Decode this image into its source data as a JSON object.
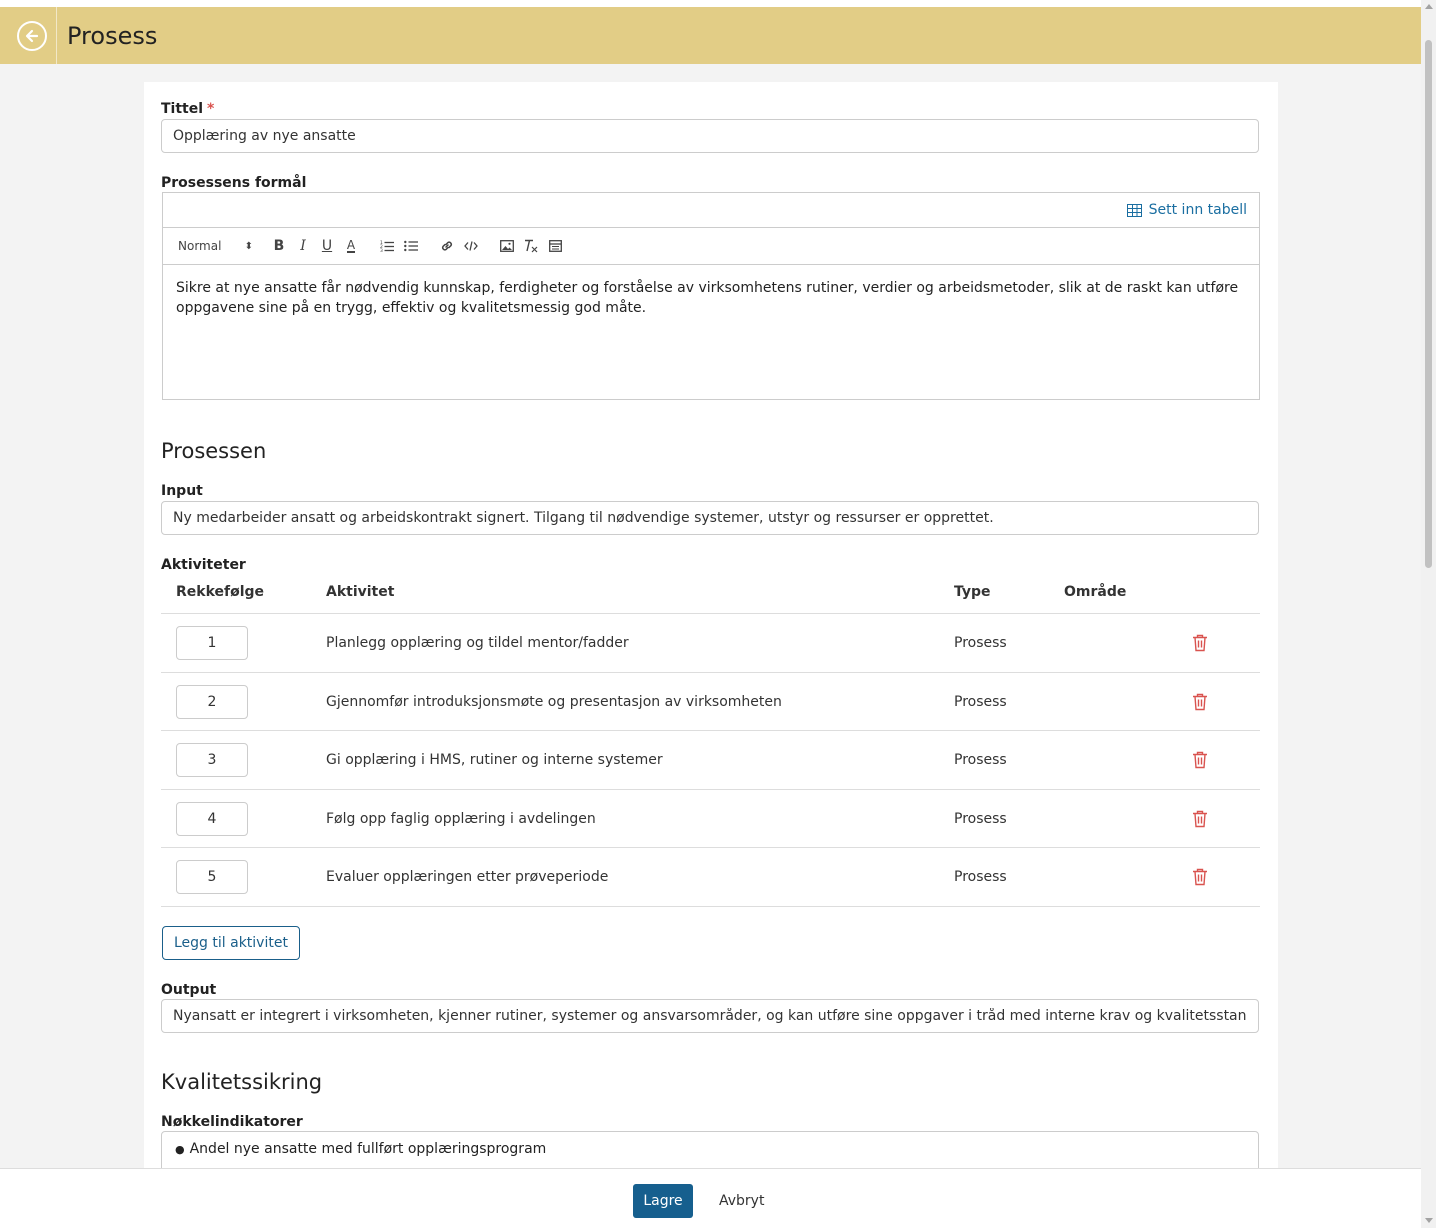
{
  "header": {
    "title": "Prosess",
    "back_icon": "arrow-left-circle-icon"
  },
  "form": {
    "title_label": "Tittel",
    "required_mark": "*",
    "title_value": "Opplæring av nye ansatte",
    "purpose_label": "Prosessens formål",
    "insert_table_label": "Sett inn tabell",
    "toolbar": {
      "format_select": "Normal",
      "format_arrows": "⬍",
      "bold": "B",
      "italic": "I",
      "underline": "U",
      "text_color": "A"
    },
    "purpose_text": "Sikre at nye ansatte får nødvendig kunnskap, ferdigheter og forståelse av virksomhetens rutiner, verdier og arbeidsmetoder, slik at de raskt kan utføre oppgavene sine på en trygg, effektiv og kvalitetsmessig god måte.",
    "section_process": "Prosessen",
    "input_label": "Input",
    "input_value": "Ny medarbeider ansatt og arbeidskontrakt signert. Tilgang til nødvendige systemer, utstyr og ressurser er opprettet.",
    "activities_label": "Aktiviteter",
    "columns": {
      "order": "Rekkefølge",
      "activity": "Aktivitet",
      "type": "Type",
      "area": "Område"
    },
    "activities": [
      {
        "order": "1",
        "activity": "Planlegg opplæring og tildel mentor/fadder",
        "type": "Prosess",
        "area": ""
      },
      {
        "order": "2",
        "activity": "Gjennomfør introduksjonsmøte og presentasjon av virksomheten",
        "type": "Prosess",
        "area": ""
      },
      {
        "order": "3",
        "activity": "Gi opplæring i HMS, rutiner og interne systemer",
        "type": "Prosess",
        "area": ""
      },
      {
        "order": "4",
        "activity": "Følg opp faglig opplæring i avdelingen",
        "type": "Prosess",
        "area": ""
      },
      {
        "order": "5",
        "activity": "Evaluer opplæringen etter prøveperiode",
        "type": "Prosess",
        "area": ""
      }
    ],
    "add_activity_label": "Legg til aktivitet",
    "output_label": "Output",
    "output_value": "Nyansatt er integrert i virksomheten, kjenner rutiner, systemer og ansvarsområder, og kan utføre sine oppgaver i tråd med interne krav og kvalitetsstandarder.",
    "section_quality": "Kvalitetssikring",
    "kpi_label": "Nøkkelindikatorer",
    "kpi_bullet": "●",
    "kpi_items": [
      "Andel nye ansatte med fullført opplæringsprogram"
    ]
  },
  "footer": {
    "save_label": "Lagre",
    "cancel_label": "Avbryt"
  },
  "colors": {
    "header_bg": "#e2cd86",
    "primary": "#165f8e",
    "link": "#1a6ea1",
    "danger": "#d9534f"
  }
}
